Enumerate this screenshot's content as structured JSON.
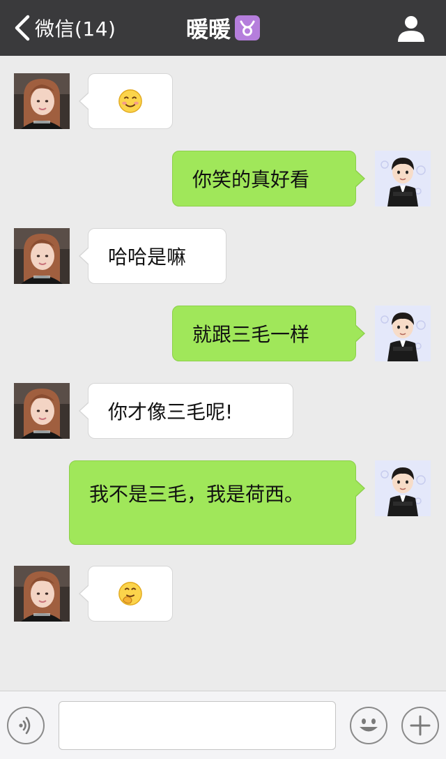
{
  "header": {
    "back_label": "微信(14)",
    "title": "暖暖",
    "zodiac_symbol": "♉"
  },
  "messages": [
    {
      "side": "in",
      "type": "emoji",
      "emoji": "blushing-smile-emoji"
    },
    {
      "side": "out",
      "type": "text",
      "text": "你笑的真好看"
    },
    {
      "side": "in",
      "type": "text",
      "text": "哈哈是嘛"
    },
    {
      "side": "out",
      "type": "text",
      "text": "就跟三毛一样"
    },
    {
      "side": "in",
      "type": "text",
      "text": "你才像三毛呢!"
    },
    {
      "side": "out",
      "type": "text",
      "text": "我不是三毛，我是荷西。"
    },
    {
      "side": "in",
      "type": "emoji",
      "emoji": "giggle-emoji"
    }
  ],
  "input": {
    "value": "",
    "placeholder": ""
  },
  "icons": {
    "voice": "voice-icon",
    "sticker": "smiley-icon",
    "more": "plus-icon",
    "profile": "person-icon",
    "back": "chevron-left-icon"
  },
  "colors": {
    "topbar": "#3a3a3c",
    "chat_background": "#ebebeb",
    "outgoing_bubble": "#a0e75a",
    "incoming_bubble": "#ffffff",
    "zodiac_badge": "#b57edc"
  }
}
